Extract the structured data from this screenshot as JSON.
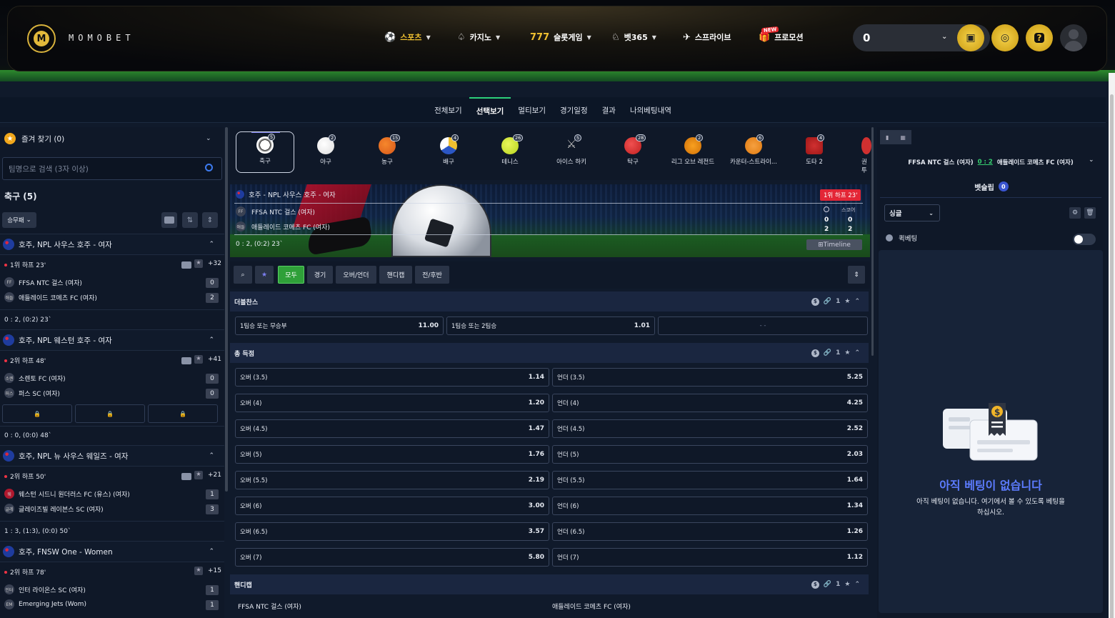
{
  "header": {
    "brand": "MOMOBET",
    "logo_letter": "M",
    "nav": [
      {
        "label": "스포츠",
        "icon": "soccer-icon"
      },
      {
        "label": "카지노",
        "icon": "spade-icon"
      },
      {
        "label": "슬롯게임",
        "icon": "slot-icon"
      },
      {
        "label": "벳365",
        "icon": "chess-knight-icon"
      },
      {
        "label": "스프라이브",
        "icon": "plane-icon"
      },
      {
        "label": "프로모션",
        "icon": "gift-icon"
      }
    ],
    "new_badge": "NEW",
    "balance": "0",
    "help": "?"
  },
  "subnav": [
    "전체보기",
    "선택보기",
    "멀티보기",
    "경기일정",
    "결과",
    "나의베팅내역"
  ],
  "left": {
    "favorites": "즐겨 찾기 (0)",
    "search_placeholder": "팀명으로 검색 (3자 이상)",
    "sport_title": "축구 (5)",
    "filter": "승무패",
    "leagues": [
      {
        "name": "호주, NPL 사우스 호주 - 여자",
        "status": "1위 하프 23'",
        "plus": "+32",
        "teams": [
          {
            "badge": "FF",
            "name": "FFSA NTC 걸스 (여자)",
            "score": "0"
          },
          {
            "badge": "애들",
            "name": "애들레이드 코메츠 FC (여자)",
            "score": "2"
          }
        ],
        "result": "0 : 2, (0:2) 23`"
      },
      {
        "name": "호주, NPL 웨스턴 호주 - 여자",
        "status": "2위 하프 48'",
        "plus": "+41",
        "teams": [
          {
            "badge": "소렌",
            "name": "소렌토 FC (여자)",
            "score": "0"
          },
          {
            "badge": "퍼스",
            "name": "퍼스 SC (여자)",
            "score": "0"
          }
        ],
        "result": "0 : 0, (0:0) 48`"
      },
      {
        "name": "호주, NPL 뉴 사우스 웨일즈 - 여자",
        "status": "2위 하프 50'",
        "plus": "+21",
        "teams": [
          {
            "badge": "웨",
            "name": "웨스턴 시드니 원더러스 FC (유스) (여자)",
            "score": "1"
          },
          {
            "badge": "글레",
            "name": "글레이즈빌 레이븐스 SC (여자)",
            "score": "3"
          }
        ],
        "result": "1 : 3, (1:3), (0:0) 50`"
      },
      {
        "name": "호주, FNSW One - Women",
        "status": "2위 하프 78'",
        "plus": "+15",
        "teams": [
          {
            "badge": "인터",
            "name": "인터 라이온스 SC (여자)",
            "score": "1"
          },
          {
            "badge": "EM",
            "name": "Emerging Jets (Wom)",
            "score": "1"
          }
        ]
      }
    ]
  },
  "sports": [
    {
      "label": "축구",
      "count": "5"
    },
    {
      "label": "야구",
      "count": "2"
    },
    {
      "label": "농구",
      "count": "15"
    },
    {
      "label": "배구",
      "count": "4"
    },
    {
      "label": "테니스",
      "count": "26"
    },
    {
      "label": "아이스 하키",
      "count": "5"
    },
    {
      "label": "탁구",
      "count": "28"
    },
    {
      "label": "리그 오브 레전드",
      "count": "2"
    },
    {
      "label": "카운터-스트라이...",
      "count": "6"
    },
    {
      "label": "도타 2",
      "count": "4"
    },
    {
      "label": "권투",
      "count": ""
    }
  ],
  "banner": {
    "league": "호주 - NPL 사우스 호주 - 여자",
    "live": "1위 하프 23'",
    "team1_badge": "FF",
    "team1": "FFSA NTC 걸스 (여자)",
    "team2_badge": "애들",
    "team2": "애들레이드 코메츠 FC (여자)",
    "score_label": "스코어",
    "t1_half": "0",
    "t1_score": "0",
    "t2_half": "2",
    "t2_score": "2",
    "result": "0 : 2, (0:2) 23`",
    "timeline": "Timeline"
  },
  "filters": [
    "모두",
    "경기",
    "오버/언더",
    "핸디캡",
    "전/후반"
  ],
  "markets": {
    "double": {
      "title": "더블찬스",
      "link_count": "1",
      "odds": [
        {
          "label": "1팀승 또는 무승부",
          "value": "11.00"
        },
        {
          "label": "1팀승 또는 2팀승",
          "value": "1.01"
        },
        {
          "label": "- -",
          "value": ""
        }
      ]
    },
    "total": {
      "title": "총 득점",
      "link_count": "1",
      "rows": [
        {
          "over": "오버 (3.5)",
          "ov": "1.14",
          "under": "언더 (3.5)",
          "uv": "5.25"
        },
        {
          "over": "오버 (4)",
          "ov": "1.20",
          "under": "언더 (4)",
          "uv": "4.25"
        },
        {
          "over": "오버 (4.5)",
          "ov": "1.47",
          "under": "언더 (4.5)",
          "uv": "2.52"
        },
        {
          "over": "오버 (5)",
          "ov": "1.76",
          "under": "언더 (5)",
          "uv": "2.03"
        },
        {
          "over": "오버 (5.5)",
          "ov": "2.19",
          "under": "언더 (5.5)",
          "uv": "1.64"
        },
        {
          "over": "오버 (6)",
          "ov": "3.00",
          "under": "언더 (6)",
          "uv": "1.34"
        },
        {
          "over": "오버 (6.5)",
          "ov": "3.57",
          "under": "언더 (6.5)",
          "uv": "1.26"
        },
        {
          "over": "오버 (7)",
          "ov": "5.80",
          "under": "언더 (7)",
          "uv": "1.12"
        }
      ]
    },
    "handicap": {
      "title": "핸디캡",
      "link_count": "1",
      "team1": "FFSA NTC 걸스 (여자)",
      "team2": "애들레이드 코메츠 FC (여자)"
    }
  },
  "right": {
    "match_t1": "FFSA NTC 걸스 (여자)",
    "match_score": "0 : 2",
    "match_t2": "애들레이드 코메츠 FC (여자)",
    "betslip": "벳슬립",
    "betslip_count": "0",
    "single": "싱글",
    "quick": "퀵베팅",
    "empty_title": "아직 베팅이 없습니다",
    "empty_desc": "아직 베팅이 없습니다. 여기에서 볼 수 있도록 베팅을 하십시오."
  },
  "colors": {
    "accent_gold": "#f0c030",
    "live_red": "#e32636",
    "green": "#2fa039",
    "blue": "#5c7cff"
  }
}
